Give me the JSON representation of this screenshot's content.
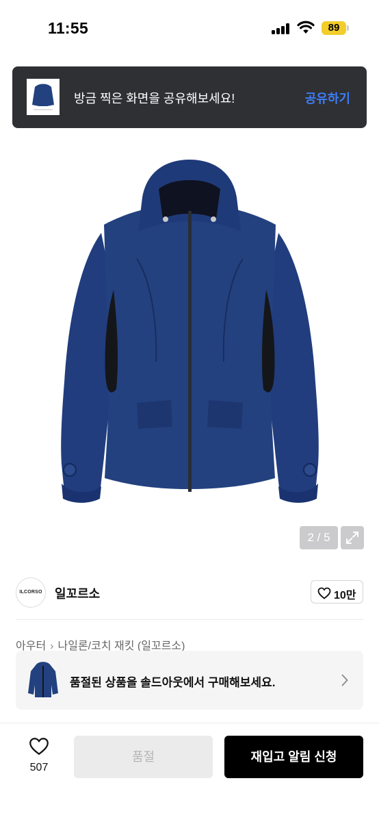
{
  "status_bar": {
    "time": "11:55",
    "battery": "89"
  },
  "share_toast": {
    "message": "방금 찍은 화면을 공유해보세요!",
    "action": "공유하기"
  },
  "gallery": {
    "counter": "2 / 5"
  },
  "brand": {
    "logo_text": "ILCORSO",
    "name": "일꼬르소",
    "likes": "10만"
  },
  "breadcrumb": {
    "category": "아우터",
    "subcategory": "나일론/코치 재킷 (일꼬르소)"
  },
  "soldout_banner": {
    "text": "품절된 상품을 솔드아웃에서 구매해보세요."
  },
  "bottom_bar": {
    "wish_count": "507",
    "soldout_label": "품절",
    "restock_label": "재입고 알림 신청"
  },
  "colors": {
    "accent_blue": "#3d7df6",
    "jacket_navy": "#1f3a7a",
    "battery_yellow": "#f2cd2b"
  }
}
